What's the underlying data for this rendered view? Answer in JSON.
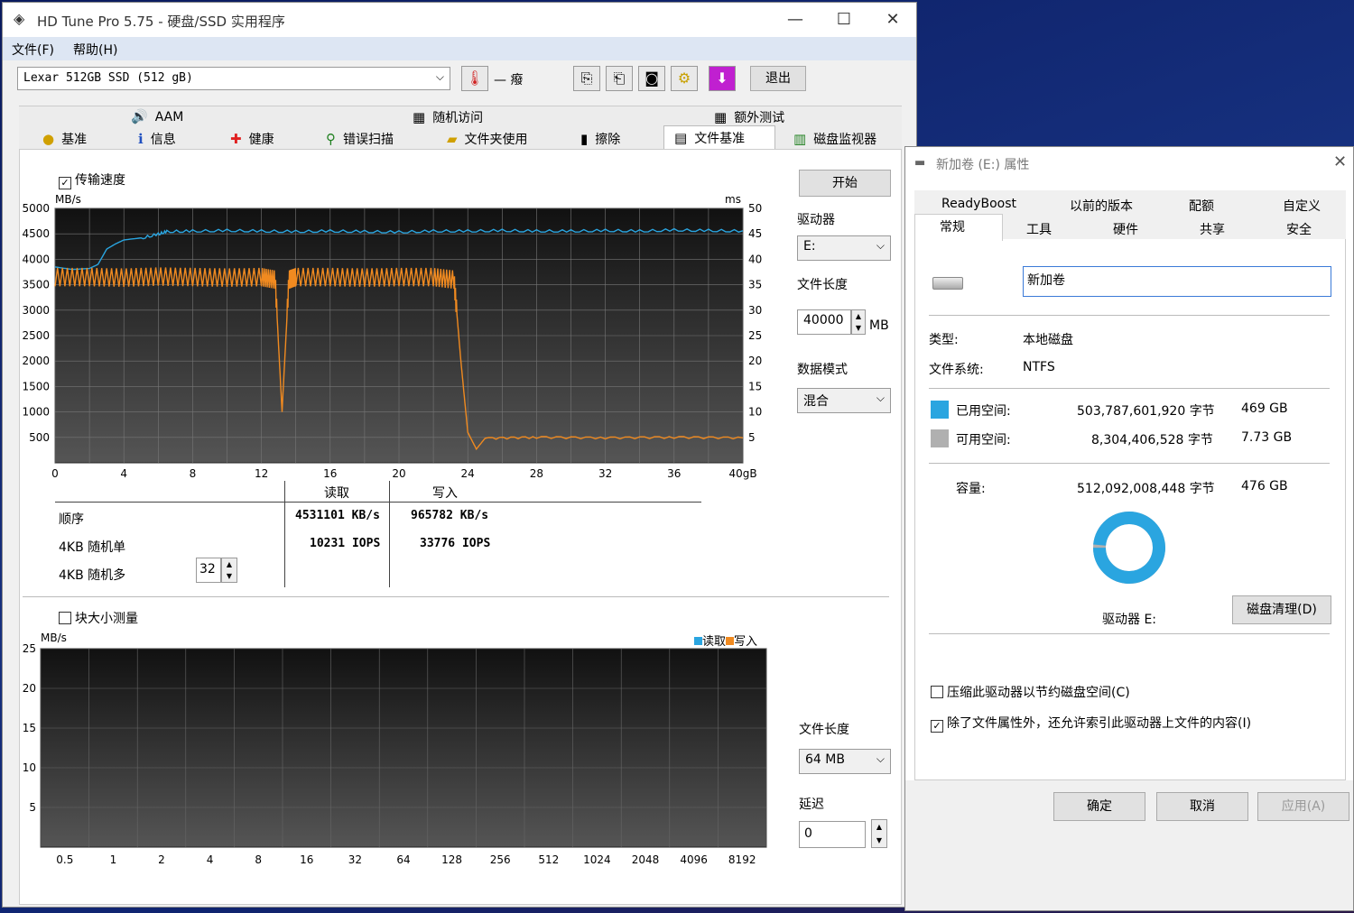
{
  "hdtune": {
    "title": "HD Tune Pro 5.75 - 硬盘/SSD 实用程序",
    "menu": [
      "文件(F)",
      "帮助(H)"
    ],
    "drive": "Lexar 512GB SSD (512 gB)",
    "temp": "— 癈",
    "exit": "退出",
    "tabs_top": [
      "AAM",
      "随机访问",
      "额外测试"
    ],
    "tabs_bottom": [
      "基准",
      "信息",
      "健康",
      "错误扫描",
      "文件夹使用",
      "擦除",
      "文件基准",
      "磁盘监视器"
    ],
    "transfer_speed": "传输速度",
    "start": "开始",
    "drive_label": "驱动器",
    "drive_value": "E:",
    "file_length_label": "文件长度",
    "file_length_value": "40000",
    "mb": "MB",
    "data_mode_label": "数据模式",
    "data_mode_value": "混合",
    "unit_left": "MB/s",
    "unit_right": "ms",
    "results": {
      "read_hdr": "读取",
      "write_hdr": "写入",
      "row1": "顺序",
      "row2": "4KB 随机单",
      "row3": "4KB 随机多",
      "seq_read": "4531101 KB/s",
      "seq_write": "965782 KB/s",
      "r4k_read": "10231 IOPS",
      "r4k_write": "33776 IOPS",
      "queue": "32"
    },
    "block_size": "块大小测量",
    "unit2": "MB/s",
    "legend_read": "读取",
    "legend_write": "写入",
    "file_length2_label": "文件长度",
    "file_length2_value": "64 MB",
    "delay_label": "延迟",
    "delay_value": "0"
  },
  "chart_data": [
    {
      "type": "line",
      "title": "",
      "xlabel": "",
      "ylabel": "MB/s",
      "y2label": "ms",
      "x_ticks": [
        "0",
        "4",
        "8",
        "12",
        "16",
        "20",
        "24",
        "28",
        "32",
        "36",
        "40gB"
      ],
      "y_ticks": [
        500,
        1000,
        1500,
        2000,
        2500,
        3000,
        3500,
        4000,
        4500,
        5000
      ],
      "y2_ticks": [
        5,
        10,
        15,
        20,
        25,
        30,
        35,
        40,
        45,
        50
      ],
      "xlim": [
        0,
        40
      ],
      "ylim": [
        0,
        5000
      ],
      "grid": true,
      "series": [
        {
          "name": "读取",
          "color": "#2aa5e0",
          "x": [
            0,
            1,
            2,
            2.5,
            3,
            3.5,
            4,
            5,
            6,
            6.5,
            8,
            10,
            12,
            14,
            16,
            18,
            20,
            22,
            24,
            26,
            28,
            30,
            32,
            34,
            36,
            38,
            40
          ],
          "y": [
            3850,
            3800,
            3820,
            3900,
            4200,
            4300,
            4380,
            4420,
            4500,
            4550,
            4560,
            4570,
            4560,
            4550,
            4560,
            4550,
            4540,
            4560,
            4560,
            4570,
            4560,
            4560,
            4570,
            4560,
            4580,
            4570,
            4560
          ]
        },
        {
          "name": "写入",
          "color": "#f08a20",
          "x": [
            0,
            2,
            4,
            6,
            8,
            10,
            12,
            12.8,
            13.2,
            13.6,
            14,
            16,
            18,
            20,
            22,
            23.2,
            23.6,
            24,
            24.5,
            25,
            28,
            32,
            36,
            40
          ],
          "y": [
            3650,
            3650,
            3640,
            3660,
            3650,
            3640,
            3650,
            3600,
            1000,
            3600,
            3650,
            3650,
            3640,
            3650,
            3650,
            3600,
            2000,
            600,
            270,
            480,
            500,
            490,
            500,
            490
          ]
        }
      ]
    },
    {
      "type": "bar",
      "title": "",
      "xlabel": "",
      "ylabel": "MB/s",
      "categories": [
        "0.5",
        "1",
        "2",
        "4",
        "8",
        "16",
        "32",
        "64",
        "128",
        "256",
        "512",
        "1024",
        "2048",
        "4096",
        "8192"
      ],
      "y_ticks": [
        5,
        10,
        15,
        20,
        25
      ],
      "ylim": [
        0,
        25
      ],
      "grid": true,
      "series": [
        {
          "name": "读取",
          "values": [],
          "color": "#2aa5e0"
        },
        {
          "name": "写入",
          "values": [],
          "color": "#f08a20"
        }
      ]
    }
  ],
  "props": {
    "title": "新加卷 (E:) 属性",
    "tabs_row1": [
      "ReadyBoost",
      "以前的版本",
      "配额",
      "自定义"
    ],
    "tabs_row2": [
      "常规",
      "工具",
      "硬件",
      "共享",
      "安全"
    ],
    "name": "新加卷",
    "type_label": "类型:",
    "type_value": "本地磁盘",
    "fs_label": "文件系统:",
    "fs_value": "NTFS",
    "used_label": "已用空间:",
    "used_bytes": "503,787,601,920 字节",
    "used_gb": "469 GB",
    "free_label": "可用空间:",
    "free_bytes": "8,304,406,528 字节",
    "free_gb": "7.73 GB",
    "cap_label": "容量:",
    "cap_bytes": "512,092,008,448 字节",
    "cap_gb": "476 GB",
    "used_fraction": 0.984,
    "used_color": "#2aa5e0",
    "free_color": "#b0b0b0",
    "drive_label": "驱动器 E:",
    "cleanup": "磁盘清理(D)",
    "compress": "压缩此驱动器以节约磁盘空间(C)",
    "index": "除了文件属性外，还允许索引此驱动器上文件的内容(I)",
    "ok": "确定",
    "cancel": "取消",
    "apply": "应用(A)"
  }
}
